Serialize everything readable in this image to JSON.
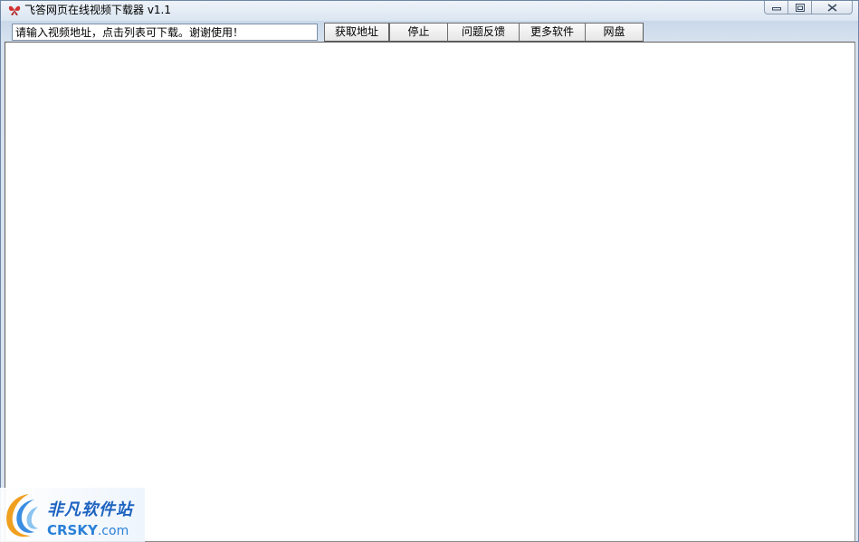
{
  "window": {
    "title": "飞答网页在线视频下载器 v1.1"
  },
  "toolbar": {
    "url_input_value": "请输入视频地址，点击列表可下载。谢谢使用！",
    "buttons": [
      {
        "id": "get-address",
        "label": "获取地址"
      },
      {
        "id": "stop",
        "label": "停止"
      },
      {
        "id": "feedback",
        "label": "问题反馈"
      },
      {
        "id": "more-software",
        "label": "更多软件"
      },
      {
        "id": "netdisk",
        "label": "网盘"
      }
    ]
  },
  "watermark": {
    "cn_text": "非凡软件站",
    "en_text_main": "CRSKY",
    "en_text_suffix": ".com"
  },
  "icons": {
    "app": "butterfly-app-icon",
    "minimize": "minimize-icon",
    "maximize": "maximize-icon",
    "close": "close-icon",
    "watermark_logo": "crsky-logo-icon"
  },
  "colors": {
    "accent": "#1d63c0",
    "title_gradient_top": "#eef3f9",
    "content_bg": "#ffffff"
  }
}
